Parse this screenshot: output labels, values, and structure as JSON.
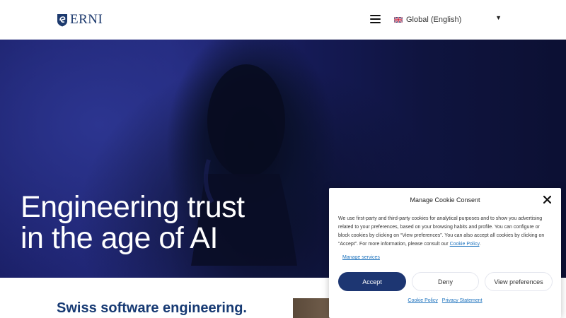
{
  "header": {
    "logo_text": "ERNI",
    "language": "Global (English)"
  },
  "hero": {
    "title_line1": "Engineering trust",
    "title_line2": "in the age of AI"
  },
  "section": {
    "heading": "Swiss software engineering."
  },
  "cookie_banner": {
    "title": "Manage Cookie Consent",
    "body": "We use first-party and third-party cookies for analytical purposes and to show you advertising related to your preferences, based on your browsing habits and profile. You can configure or block cookies by clicking on “View preferences”. You can also accept all cookies by clicking on “Accept”. For more information, please consult our",
    "policy_link": "Cookie Policy",
    "manage_link": "Manage services",
    "accept": "Accept",
    "deny": "Deny",
    "view_preferences": "View preferences",
    "footer_cookie_policy": "Cookie Policy",
    "footer_privacy": "Privacy Statement"
  },
  "colors": {
    "brand": "#1d3a6e",
    "accept_button": "#1d3672",
    "link": "#1e73be"
  },
  "icons": [
    "erni-logo-icon",
    "hamburger-menu-icon",
    "uk-flag-icon",
    "caret-down-icon",
    "close-icon"
  ]
}
